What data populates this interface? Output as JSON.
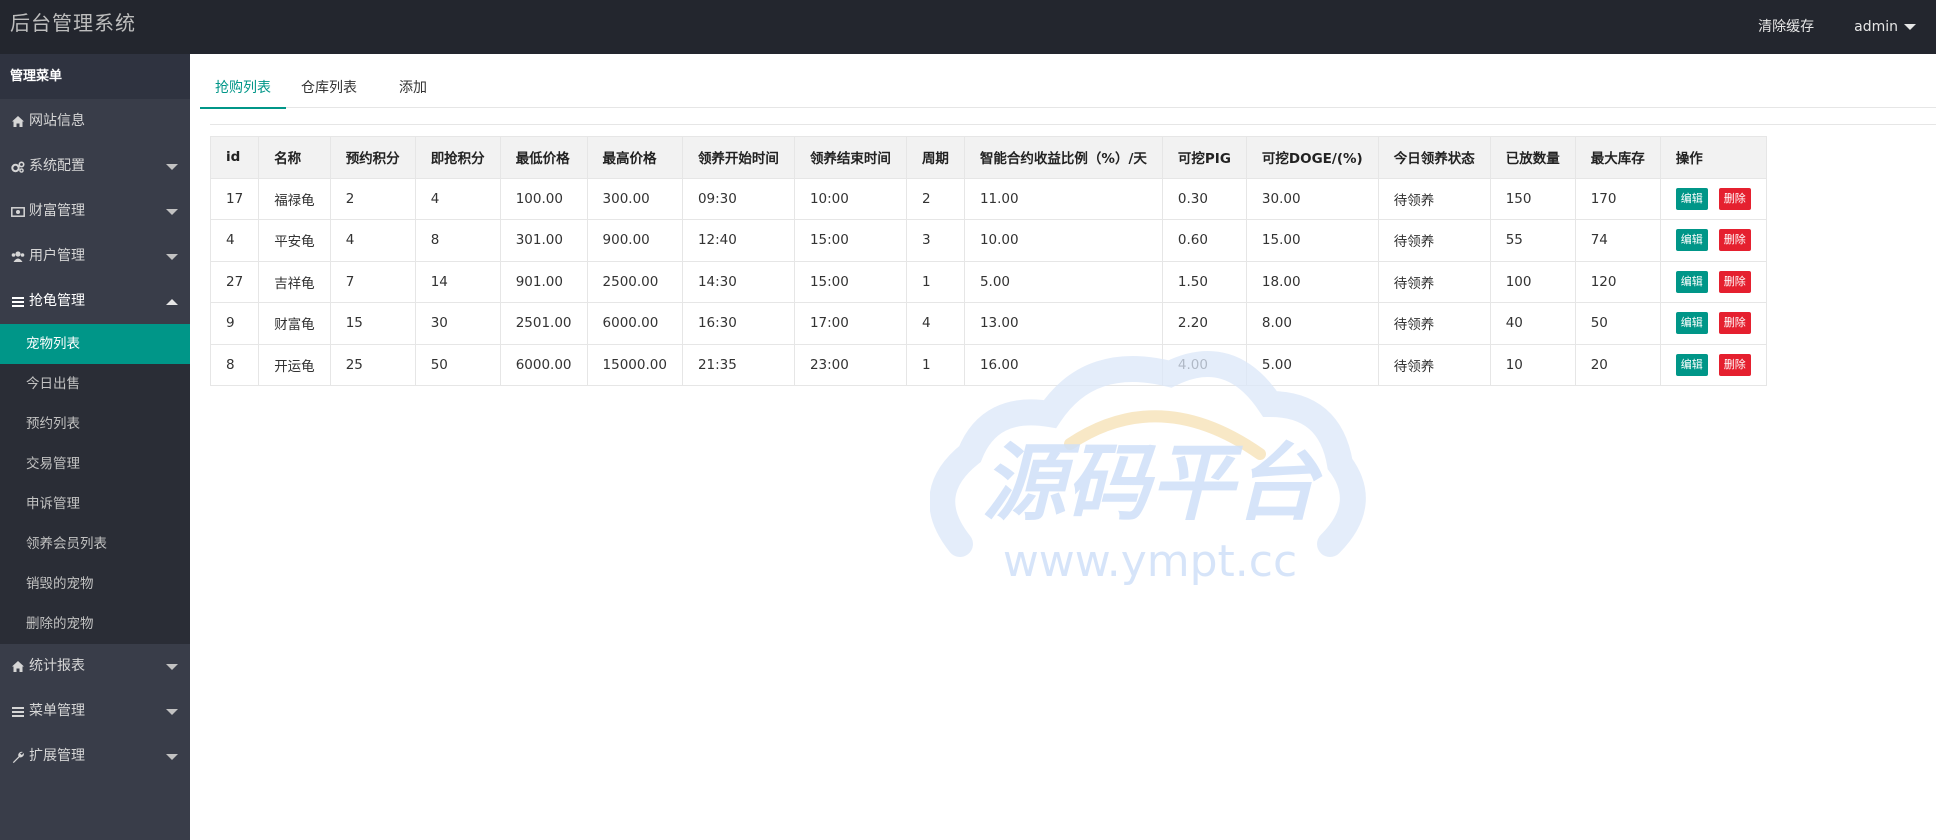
{
  "header": {
    "logo": "后台管理系统",
    "clear_cache": "清除缓存",
    "user": "admin"
  },
  "sidebar": {
    "title": "管理菜单",
    "items": [
      {
        "label": "网站信息",
        "icon": "home-icon",
        "has_arrow": false
      },
      {
        "label": "系统配置",
        "icon": "gears-icon",
        "has_arrow": true
      },
      {
        "label": "财富管理",
        "icon": "money-icon",
        "has_arrow": true
      },
      {
        "label": "用户管理",
        "icon": "users-icon",
        "has_arrow": true
      },
      {
        "label": "抢龟管理",
        "icon": "list-icon",
        "has_arrow": true,
        "expanded": true
      }
    ],
    "sub_items": [
      "宠物列表",
      "今日出售",
      "预约列表",
      "交易管理",
      "申诉管理",
      "领养会员列表",
      "销毁的宠物",
      "删除的宠物"
    ],
    "active_sub": "宠物列表",
    "bottom_items": [
      {
        "label": "统计报表",
        "icon": "home-icon"
      },
      {
        "label": "菜单管理",
        "icon": "list-icon"
      },
      {
        "label": "扩展管理",
        "icon": "wrench-icon"
      }
    ]
  },
  "tabs": [
    "抢购列表",
    "仓库列表",
    "添加"
  ],
  "active_tab": "抢购列表",
  "table": {
    "headers": [
      "id",
      "名称",
      "预约积分",
      "即抢积分",
      "最低价格",
      "最高价格",
      "领养开始时间",
      "领养结束时间",
      "周期",
      "智能合约收益比例（%）/天",
      "可挖PIG",
      "可挖DOGE/(%)",
      "今日领养状态",
      "已放数量",
      "最大库存",
      "操作"
    ],
    "rows": [
      [
        "17",
        "福禄龟",
        "2",
        "4",
        "100.00",
        "300.00",
        "09:30",
        "10:00",
        "2",
        "11.00",
        "0.30",
        "30.00",
        "待领养",
        "150",
        "170"
      ],
      [
        "4",
        "平安龟",
        "4",
        "8",
        "301.00",
        "900.00",
        "12:40",
        "15:00",
        "3",
        "10.00",
        "0.60",
        "15.00",
        "待领养",
        "55",
        "74"
      ],
      [
        "27",
        "吉祥龟",
        "7",
        "14",
        "901.00",
        "2500.00",
        "14:30",
        "15:00",
        "1",
        "5.00",
        "1.50",
        "18.00",
        "待领养",
        "100",
        "120"
      ],
      [
        "9",
        "财富龟",
        "15",
        "30",
        "2501.00",
        "6000.00",
        "16:30",
        "17:00",
        "4",
        "13.00",
        "2.20",
        "8.00",
        "待领养",
        "40",
        "50"
      ],
      [
        "8",
        "开运龟",
        "25",
        "50",
        "6000.00",
        "15000.00",
        "21:35",
        "23:00",
        "1",
        "16.00",
        "4.00",
        "5.00",
        "待领养",
        "10",
        "20"
      ]
    ],
    "edit_label": "编辑",
    "delete_label": "删除"
  },
  "watermark": {
    "title": "源码平台",
    "url": "www.ympt.cc"
  },
  "colors": {
    "header_bg": "#23262e",
    "sidebar_bg": "#393d49",
    "accent": "#009688",
    "danger": "#e5202f"
  }
}
